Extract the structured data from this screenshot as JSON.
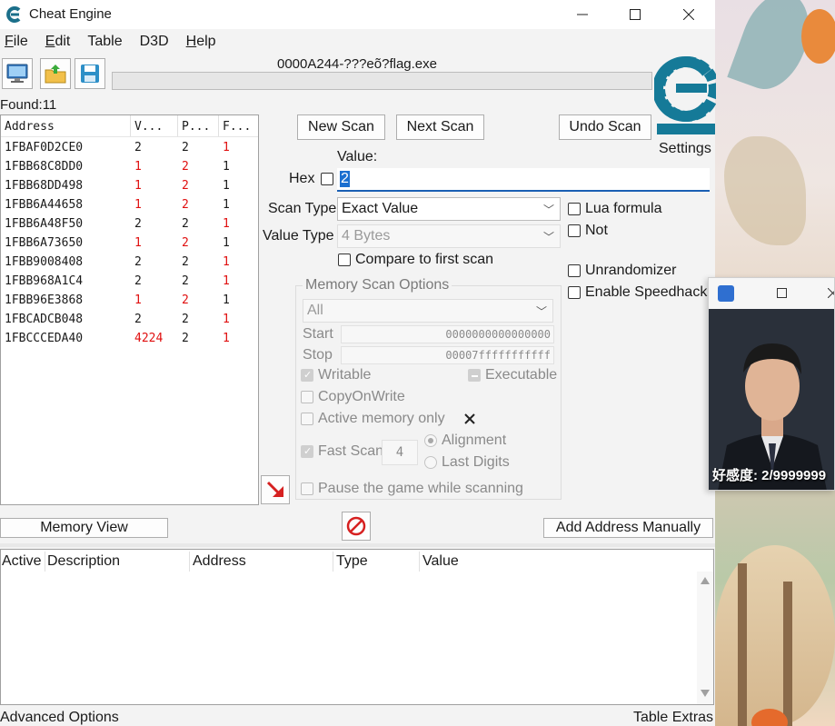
{
  "window": {
    "title": "Cheat Engine",
    "process": "0000A244-???eõ?flag.exe"
  },
  "menu": [
    {
      "label": "File",
      "u": "F",
      "rest": "ile"
    },
    {
      "label": "Edit",
      "u": "E",
      "rest": "dit"
    },
    {
      "label": "Table",
      "u": "",
      "rest": "Table"
    },
    {
      "label": "D3D",
      "u": "",
      "rest": "D3D"
    },
    {
      "label": "Help",
      "u": "H",
      "rest": "elp"
    }
  ],
  "found": "Found:11",
  "results": {
    "headers": [
      "Address",
      "V...",
      "P...",
      "F..."
    ],
    "rows": [
      [
        "1FBAF0D2CE0",
        "2",
        "2",
        "1"
      ],
      [
        "1FBB68C8DD0",
        "1",
        "2",
        "1"
      ],
      [
        "1FBB68DD498",
        "1",
        "2",
        "1"
      ],
      [
        "1FBB6A44658",
        "1",
        "2",
        "1"
      ],
      [
        "1FBB6A48F50",
        "2",
        "2",
        "1"
      ],
      [
        "1FBB6A73650",
        "1",
        "2",
        "1"
      ],
      [
        "1FBB9008408",
        "2",
        "2",
        "1"
      ],
      [
        "1FBB968A1C4",
        "2",
        "2",
        "1"
      ],
      [
        "1FBB96E3868",
        "1",
        "2",
        "1"
      ],
      [
        "1FBCADCB048",
        "2",
        "2",
        "1"
      ],
      [
        "1FBCCCEDA40",
        "4224",
        "2",
        "1"
      ]
    ]
  },
  "buttons": {
    "new_scan": "New Scan",
    "next_scan": "Next Scan",
    "undo_scan": "Undo Scan",
    "settings": "Settings",
    "memory_view": "Memory View",
    "add_address": "Add Address Manually"
  },
  "scan": {
    "value_label": "Value:",
    "hex_label": "Hex",
    "value": "2",
    "scan_type_label": "Scan Type",
    "scan_type": "Exact Value",
    "value_type_label": "Value Type",
    "value_type": "4 Bytes",
    "compare_first": "Compare to first scan",
    "lua_formula": "Lua formula",
    "not": "Not",
    "unrandomizer": "Unrandomizer",
    "speedhack": "Enable Speedhack"
  },
  "memory": {
    "title": "Memory Scan Options",
    "region": "All",
    "start_label": "Start",
    "start": "0000000000000000",
    "stop_label": "Stop",
    "stop": "00007fffffffffff",
    "writable": "Writable",
    "executable": "Executable",
    "copyonwrite": "CopyOnWrite",
    "active_only": "Active memory only",
    "fast_scan": "Fast Scan",
    "fast_scan_value": "4",
    "alignment": "Alignment",
    "last_digits": "Last Digits",
    "pause": "Pause the game while scanning"
  },
  "table": {
    "headers": [
      "Active",
      "Description",
      "Address",
      "Type",
      "Value"
    ]
  },
  "footer": {
    "left": "Advanced Options",
    "right": "Table Extras"
  },
  "mini": {
    "caption": "好感度: 2/9999999"
  }
}
